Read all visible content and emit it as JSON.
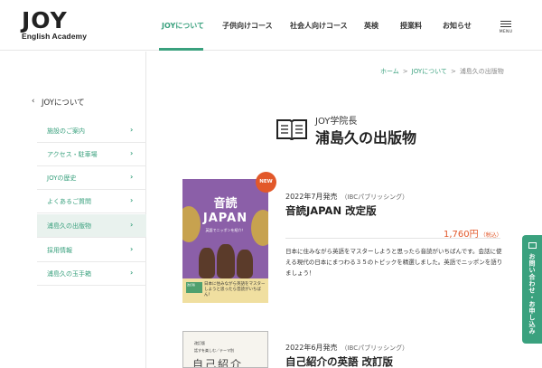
{
  "header": {
    "logo_main": "JOY",
    "logo_sub": "English Academy",
    "nav": [
      {
        "label": "JOYについて"
      },
      {
        "label": "子供向けコース"
      },
      {
        "label": "社会人向けコース"
      },
      {
        "label": "英検"
      },
      {
        "label": "授業料"
      },
      {
        "label": "お知らせ"
      }
    ],
    "menu_label": "MENU"
  },
  "sidebar": {
    "title": "JOYについて",
    "items": [
      {
        "label": "施設のご案内"
      },
      {
        "label": "アクセス・駐車場"
      },
      {
        "label": "JOYの歴史"
      },
      {
        "label": "よくあるご質問"
      },
      {
        "label": "浦島久の出版物"
      },
      {
        "label": "採用情報"
      },
      {
        "label": "浦島久の玉手箱"
      }
    ]
  },
  "breadcrumb": {
    "home": "ホーム",
    "parent": "JOYについて",
    "current": "浦島久の出版物",
    "sep": ">"
  },
  "page": {
    "subtitle": "JOY学院長",
    "title": "浦島久の出版物"
  },
  "books": [
    {
      "badge": "NEW",
      "date": "2022年7月発売",
      "publisher": "（IBCパブリッシング）",
      "title": "音読JAPAN 改定版",
      "price": "1,760円",
      "tax": "（税込）",
      "description": "日本に住みながら英語をマスターしようと思ったら音読がいちばんです。会話に使える現代の日本にまつわる３５のトピックを精選しました。英語でニッポンを語りましょう！",
      "cover_title_1": "音読",
      "cover_title_2": "JAPAN",
      "cover_tagline": "英語でニッポンを紹介！",
      "cover_box": "日本に住みながら英語をマスターしようと思ったら音読がいちばん！",
      "cover_badge": "改訂版"
    },
    {
      "date": "2022年6月発売",
      "publisher": "（IBCパブリッシング）",
      "title": "自己紹介の英語 改訂版",
      "cover_line_1": "改訂版",
      "cover_line_2": "話すを楽しむ／テーマ別",
      "cover_line_3": "自己紹介"
    }
  ],
  "floating": {
    "label": "お問い合わせ・お申し込み"
  },
  "colors": {
    "accent": "#3aa17e",
    "price": "#e2582a",
    "badge": "#e2582a"
  }
}
